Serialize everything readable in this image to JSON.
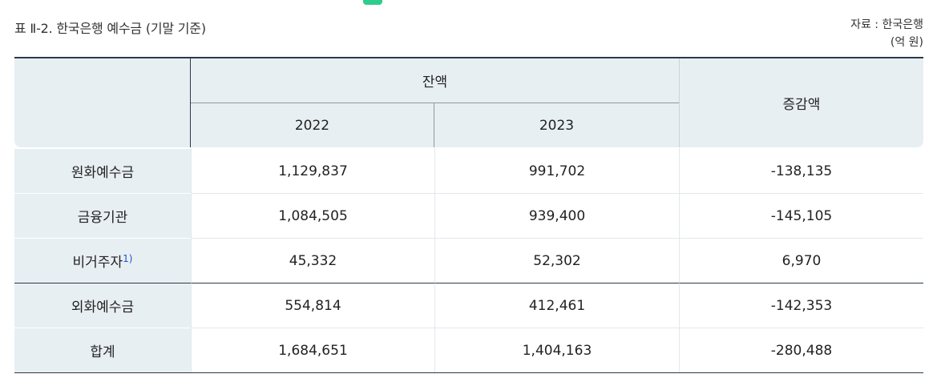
{
  "caption": "표 Ⅱ-2. 한국은행 예수금 (기말 기준)",
  "source": {
    "line1": "자료 : 한국은행",
    "line2": "(억 원)"
  },
  "header": {
    "balance": "잔액",
    "year1": "2022",
    "year2": "2023",
    "change": "증감액"
  },
  "rows": [
    {
      "label": "원화예수금",
      "footnote": "",
      "v2022": "1,129,837",
      "v2023": "991,702",
      "change": "-138,135"
    },
    {
      "label": "금융기관",
      "footnote": "",
      "v2022": "1,084,505",
      "v2023": "939,400",
      "change": "-145,105"
    },
    {
      "label": "비거주자",
      "footnote": "1)",
      "v2022": "45,332",
      "v2023": "52,302",
      "change": "6,970"
    },
    {
      "label": "외화예수금",
      "footnote": "",
      "v2022": "554,814",
      "v2023": "412,461",
      "change": "-142,353"
    },
    {
      "label": "합계",
      "footnote": "",
      "v2022": "1,684,651",
      "v2023": "1,404,163",
      "change": "-280,488"
    }
  ]
}
